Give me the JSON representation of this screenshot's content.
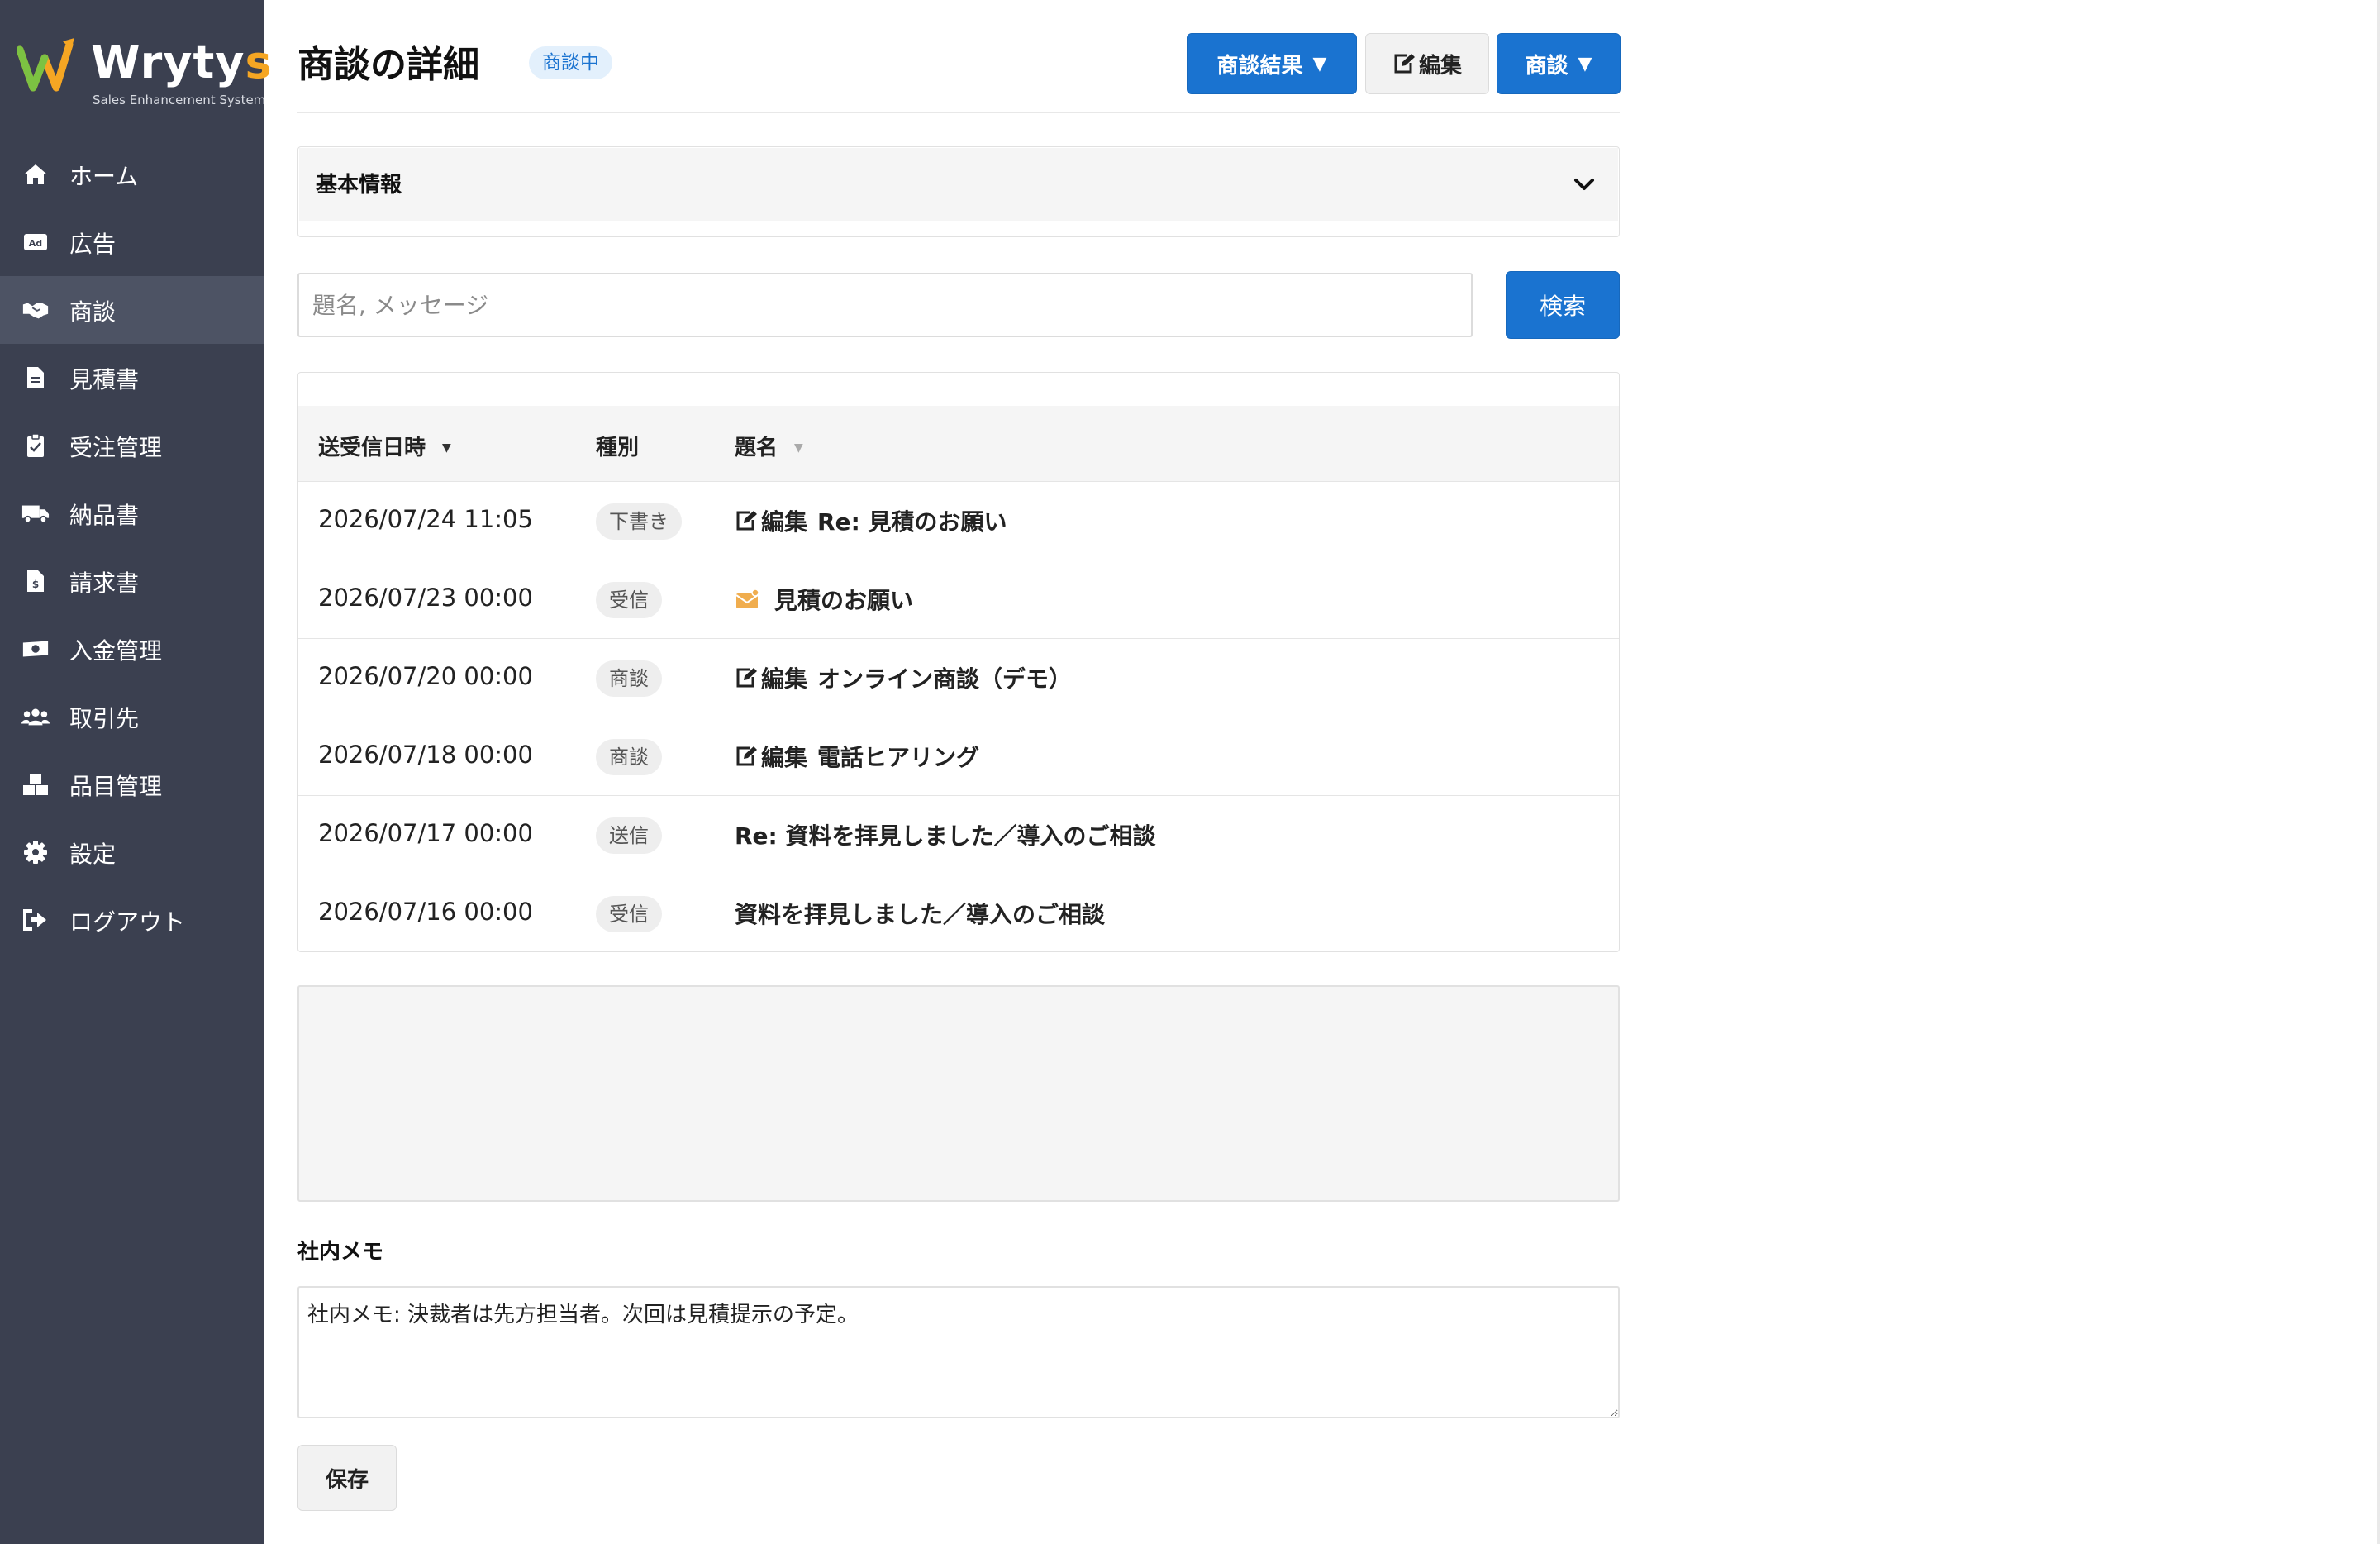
{
  "app": {
    "logo_text_main": "Wryty",
    "logo_text_accent": "s",
    "logo_tagline": "Sales Enhancement System"
  },
  "sidebar": {
    "items": [
      {
        "label": "ホーム",
        "icon": "home-icon"
      },
      {
        "label": "広告",
        "icon": "ad-icon"
      },
      {
        "label": "商談",
        "icon": "handshake-icon",
        "active": true
      },
      {
        "label": "見積書",
        "icon": "file-icon"
      },
      {
        "label": "受注管理",
        "icon": "clipboard-check-icon"
      },
      {
        "label": "納品書",
        "icon": "truck-icon"
      },
      {
        "label": "請求書",
        "icon": "invoice-icon"
      },
      {
        "label": "入金管理",
        "icon": "money-icon"
      },
      {
        "label": "取引先",
        "icon": "users-icon"
      },
      {
        "label": "品目管理",
        "icon": "boxes-icon"
      },
      {
        "label": "設定",
        "icon": "gear-icon"
      },
      {
        "label": "ログアウト",
        "icon": "logout-icon"
      }
    ]
  },
  "header": {
    "title": "商談の詳細",
    "status": "商談中",
    "result_button": "商談結果",
    "edit_button": "編集",
    "deal_button": "商談"
  },
  "basic_info": {
    "title": "基本情報"
  },
  "search": {
    "placeholder": "題名, メッセージ",
    "value": "",
    "button": "検索"
  },
  "table": {
    "columns": {
      "date": "送受信日時",
      "type": "種別",
      "subject": "題名"
    },
    "rows": [
      {
        "date": "2026/07/24 11:05",
        "type": "下書き",
        "prefix": "編集",
        "subject": "Re: 見積のお願い",
        "icon": "edit-icon"
      },
      {
        "date": "2026/07/23 00:00",
        "type": "受信",
        "prefix": "",
        "subject": "見積のお願い",
        "icon": "envelope-icon"
      },
      {
        "date": "2026/07/20 00:00",
        "type": "商談",
        "prefix": "編集",
        "subject": "オンライン商談（デモ）",
        "icon": "edit-icon"
      },
      {
        "date": "2026/07/18 00:00",
        "type": "商談",
        "prefix": "編集",
        "subject": "電話ヒアリング",
        "icon": "edit-icon"
      },
      {
        "date": "2026/07/17 00:00",
        "type": "送信",
        "prefix": "",
        "subject": "Re: 資料を拝見しました／導入のご相談",
        "icon": ""
      },
      {
        "date": "2026/07/16 00:00",
        "type": "受信",
        "prefix": "",
        "subject": "資料を拝見しました／導入のご相談",
        "icon": ""
      }
    ]
  },
  "memo": {
    "label": "社内メモ",
    "value": "社内メモ: 決裁者は先方担当者。次回は見積提示の予定。",
    "save_button": "保存"
  },
  "colors": {
    "sidebar_bg": "#3b4050",
    "sidebar_active": "#4d5364",
    "primary": "#1a73d0",
    "logo_accent": "#f5a623",
    "envelope": "#f0ad4e"
  }
}
